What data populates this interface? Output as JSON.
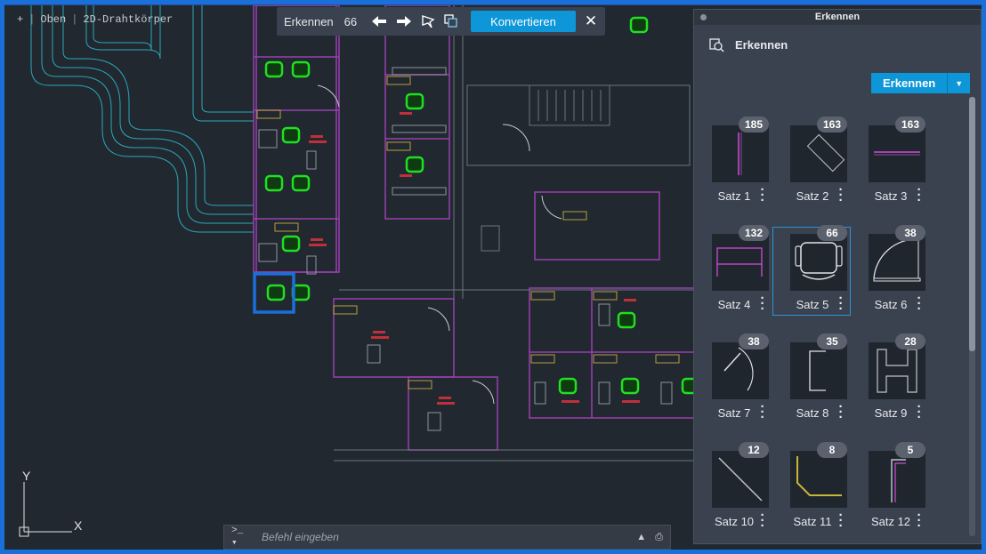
{
  "viewport": {
    "view_label_plus": "+",
    "view_label_view": "Oben",
    "view_label_style": "2D-Drahtkörper",
    "ucs_x": "X",
    "ucs_y": "Y",
    "room_tag": "NUMBER"
  },
  "toolbar": {
    "label": "Erkennen",
    "count": "66",
    "convert_label": "Konvertieren",
    "icons": [
      "arrow-left-icon",
      "arrow-right-icon",
      "flag-icon",
      "copy-icon",
      "close-icon"
    ]
  },
  "command_line": {
    "prompt": ">_ ▾",
    "placeholder": "Befehl eingeben"
  },
  "palette": {
    "title": "Erkennen",
    "header_label": "Erkennen",
    "action_label": "Erkennen",
    "sets": [
      {
        "label": "Satz 1",
        "count": "185",
        "shape": "vertical-line"
      },
      {
        "label": "Satz 2",
        "count": "163",
        "shape": "rotated-rect"
      },
      {
        "label": "Satz 3",
        "count": "163",
        "shape": "horizontal-line"
      },
      {
        "label": "Satz 4",
        "count": "132",
        "shape": "table"
      },
      {
        "label": "Satz 5",
        "count": "66",
        "shape": "chair",
        "selected": true
      },
      {
        "label": "Satz 6",
        "count": "38",
        "shape": "door-arc"
      },
      {
        "label": "Satz 7",
        "count": "38",
        "shape": "door-arc-small"
      },
      {
        "label": "Satz 8",
        "count": "35",
        "shape": "bracket"
      },
      {
        "label": "Satz 9",
        "count": "28",
        "shape": "h-beam"
      },
      {
        "label": "Satz 10",
        "count": "12",
        "shape": "diagonal-line"
      },
      {
        "label": "Satz 11",
        "count": "8",
        "shape": "yellow-corner"
      },
      {
        "label": "Satz 12",
        "count": "5",
        "shape": "double-corner"
      }
    ]
  },
  "colors": {
    "accent": "#0d96d8",
    "canvas": "#212830",
    "wall": "#9a3fb0",
    "chair_highlight": "#1fe01f",
    "selection": "#1a6fd8"
  }
}
